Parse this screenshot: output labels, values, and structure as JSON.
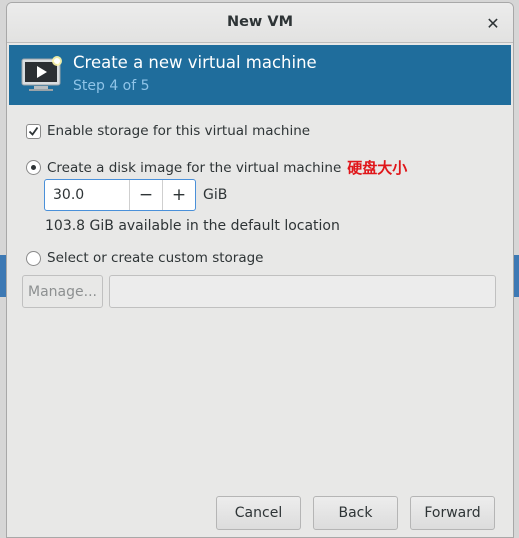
{
  "window": {
    "title": "New VM",
    "close_icon": "close-icon"
  },
  "banner": {
    "icon": "virtual-machine-icon",
    "title": "Create a new virtual machine",
    "step": "Step 4 of 5",
    "background_color": "#1f6d9c"
  },
  "storage": {
    "enable_label": "Enable storage for this virtual machine",
    "enable_checked": true,
    "disk_image_label": "Create a disk image for the virtual machine",
    "disk_image_selected": true,
    "annotation": "硬盘大小",
    "size_value": "30.0",
    "decrement_label": "−",
    "increment_label": "+",
    "unit": "GiB",
    "available_text": "103.8 GiB available in the default location",
    "custom_label": "Select or create custom storage",
    "custom_selected": false,
    "manage_label": "Manage...",
    "custom_path_value": ""
  },
  "buttons": {
    "cancel": "Cancel",
    "back": "Back",
    "forward": "Forward"
  }
}
